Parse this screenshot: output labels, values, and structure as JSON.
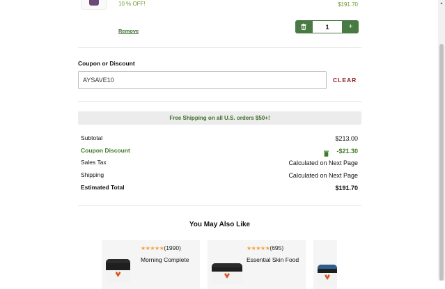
{
  "cart_item": {
    "discount_text": "10 % OFF!",
    "price": "$191.70",
    "remove_label": "Remove",
    "quantity": "1",
    "plus_label": "+"
  },
  "coupon": {
    "label": "Coupon or Discount",
    "value": "AYSAVE10",
    "clear_label": "CLEAR"
  },
  "shipping_banner": "Free Shipping on all U.S. orders $50+!",
  "summary": {
    "subtotal_label": "Subtotal",
    "subtotal_value": "$213.00",
    "discount_label": "Coupon Discount",
    "discount_value": "-$21.30",
    "tax_label": "Sales Tax",
    "tax_value": "Calculated on Next Page",
    "shipping_label": "Shipping",
    "shipping_value": "Calculated on Next Page",
    "total_label": "Estimated Total",
    "total_value": "$191.70"
  },
  "recommendations": {
    "title": "You May Also Like",
    "items": [
      {
        "stars": "★★★★★",
        "count": "(1990)",
        "name": "Morning Complete"
      },
      {
        "stars": "★★★★★",
        "count": "(695)",
        "name": "Essential Skin Food"
      }
    ]
  },
  "colors": {
    "accent_green": "#4a7a43",
    "discount_green": "#3f7a26",
    "clear_red": "#8b1a1a",
    "star_orange": "#f2a23a"
  },
  "icons": {
    "trash": "trash-icon",
    "plus": "plus-icon",
    "discount_trash": "trash-icon",
    "scroll_up": "arrow-up-icon"
  }
}
